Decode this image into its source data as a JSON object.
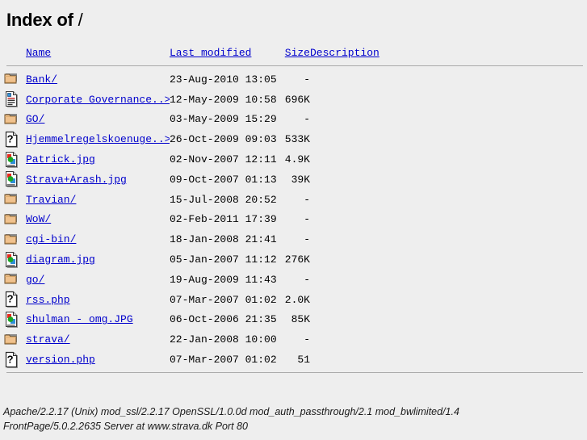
{
  "page": {
    "heading_main": "Index of",
    "heading_path": "/"
  },
  "table": {
    "headers": {
      "name": "Name",
      "last_modified": "Last modified",
      "size": "Size",
      "description": "Description"
    },
    "rows": [
      {
        "icon": "folder-icon",
        "name": "Bank/",
        "last_modified": "23-Aug-2010 13:05",
        "size": "-",
        "description": ""
      },
      {
        "icon": "document-icon",
        "name": "Corporate Governance..&gt;",
        "last_modified": "12-May-2009 10:58",
        "size": "696K",
        "description": ""
      },
      {
        "icon": "folder-icon",
        "name": "GO/",
        "last_modified": "03-May-2009 15:29",
        "size": "-",
        "description": ""
      },
      {
        "icon": "unknown-icon",
        "name": "Hjemmelregelskoenuge..&gt;",
        "last_modified": "26-Oct-2009 09:03",
        "size": "533K",
        "description": ""
      },
      {
        "icon": "image-icon",
        "name": "Patrick.jpg",
        "last_modified": "02-Nov-2007 12:11",
        "size": "4.9K",
        "description": ""
      },
      {
        "icon": "image-icon",
        "name": "Strava+Arash.jpg",
        "last_modified": "09-Oct-2007 01:13",
        "size": "39K",
        "description": ""
      },
      {
        "icon": "folder-icon",
        "name": "Travian/",
        "last_modified": "15-Jul-2008 20:52",
        "size": "-",
        "description": ""
      },
      {
        "icon": "folder-icon",
        "name": "WoW/",
        "last_modified": "02-Feb-2011 17:39",
        "size": "-",
        "description": ""
      },
      {
        "icon": "folder-icon",
        "name": "cgi-bin/",
        "last_modified": "18-Jan-2008 21:41",
        "size": "-",
        "description": ""
      },
      {
        "icon": "image-icon",
        "name": "diagram.jpg",
        "last_modified": "05-Jan-2007 11:12",
        "size": "276K",
        "description": ""
      },
      {
        "icon": "folder-icon",
        "name": "go/",
        "last_modified": "19-Aug-2009 11:43",
        "size": "-",
        "description": ""
      },
      {
        "icon": "unknown-icon",
        "name": "rss.php",
        "last_modified": "07-Mar-2007 01:02",
        "size": "2.0K",
        "description": ""
      },
      {
        "icon": "image-icon",
        "name": "shulman - omg.JPG",
        "last_modified": "06-Oct-2006 21:35",
        "size": "85K",
        "description": ""
      },
      {
        "icon": "folder-icon",
        "name": "strava/",
        "last_modified": "22-Jan-2008 10:00",
        "size": "-",
        "description": ""
      },
      {
        "icon": "unknown-icon",
        "name": "version.php",
        "last_modified": "07-Mar-2007 01:02",
        "size": "51",
        "description": ""
      }
    ]
  },
  "footer": {
    "line1": "Apache/2.2.17 (Unix) mod_ssl/2.2.17 OpenSSL/1.0.0d mod_auth_passthrough/2.1 mod_bwlimited/1.4",
    "line2": "FrontPage/5.0.2.2635 Server at www.strava.dk Port 80"
  },
  "colors": {
    "background": "#eeeeee",
    "link": "#0000cc",
    "rule": "#aaaaaa",
    "text": "#000000",
    "folder_icon": "#f5c98a",
    "image_icon_red": "#e8261c",
    "image_icon_green": "#1aa523",
    "image_icon_blue": "#2e8fd8"
  }
}
